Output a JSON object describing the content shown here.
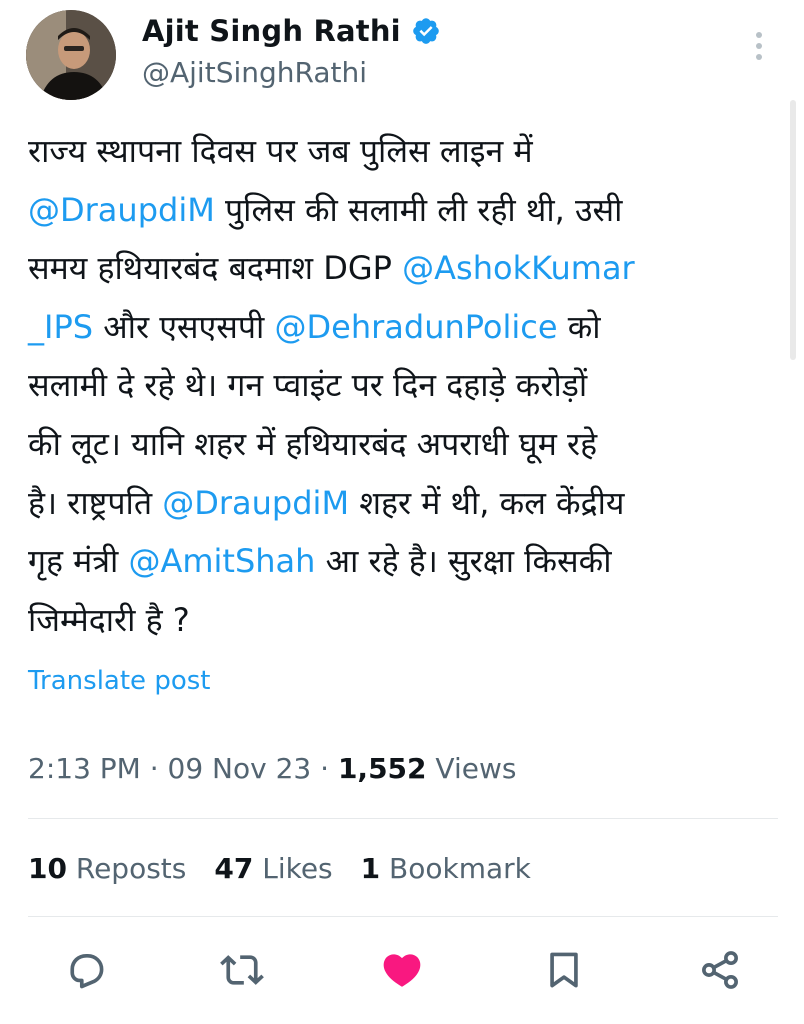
{
  "author": {
    "name": "Ajit Singh Rathi",
    "handle": "@AjitSinghRathi",
    "verified_icon": "verified-badge-icon"
  },
  "tweet_lines": [
    [
      {
        "t": "राज्य स्थापना दिवस पर जब पुलिस लाइन में",
        "m": false
      }
    ],
    [
      {
        "t": "@DraupdiM",
        "m": true
      },
      {
        "t": " पुलिस की सलामी ली रही थी,  उसी",
        "m": false
      }
    ],
    [
      {
        "t": "समय हथियारबंद बदमाश DGP  ",
        "m": false
      },
      {
        "t": "@AshokKumar",
        "m": true
      }
    ],
    [
      {
        "t": "_IPS",
        "m": true
      },
      {
        "t": " और एसएसपी ",
        "m": false
      },
      {
        "t": "@DehradunPolice",
        "m": true
      },
      {
        "t": " को",
        "m": false
      }
    ],
    [
      {
        "t": "सलामी दे रहे थे। गन प्वाइंट पर दिन दहाड़े करोड़ों",
        "m": false
      }
    ],
    [
      {
        "t": "की लूट। यानि शहर में हथियारबंद अपराधी घूम रहे",
        "m": false
      }
    ],
    [
      {
        "t": "है। राष्ट्रपति ",
        "m": false
      },
      {
        "t": "@DraupdiM",
        "m": true
      },
      {
        "t": " शहर में थी, कल केंद्रीय",
        "m": false
      }
    ],
    [
      {
        "t": "गृह मंत्री ",
        "m": false
      },
      {
        "t": "@AmitShah",
        "m": true
      },
      {
        "t": " आ रहे है। सुरक्षा किसकी",
        "m": false
      }
    ],
    [
      {
        "t": "जिम्मेदारी है ?",
        "m": false
      }
    ]
  ],
  "translate_label": "Translate post",
  "meta": {
    "time": "2:13 PM",
    "sep1": " · ",
    "date": "09 Nov 23",
    "sep2": " · ",
    "views_count": "1,552",
    "views_label": " Views"
  },
  "stats": {
    "reposts_count": "10",
    "reposts_label": " Reposts",
    "likes_count": "47",
    "likes_label": " Likes",
    "bookmarks_count": "1",
    "bookmarks_label": " Bookmark"
  },
  "colors": {
    "accent": "#1d9bf0",
    "like": "#f91880",
    "muted": "#536471"
  },
  "actions": [
    "reply-icon",
    "repost-icon",
    "like-icon",
    "bookmark-icon",
    "share-icon"
  ]
}
